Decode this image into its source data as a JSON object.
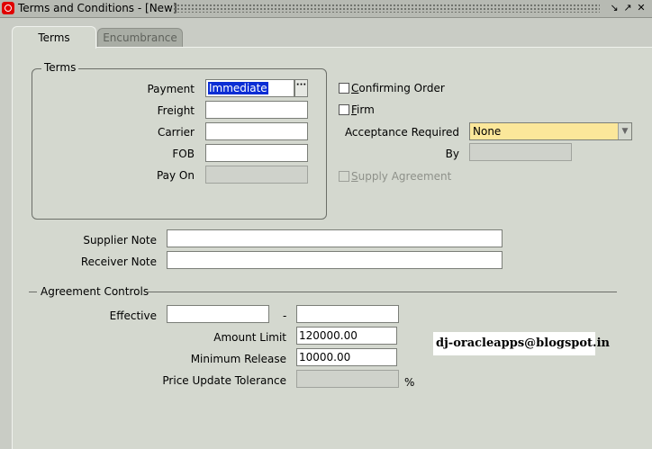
{
  "window": {
    "title": "Terms and Conditions - [New]"
  },
  "tabs": [
    {
      "label": "Terms"
    },
    {
      "label": "Encumbrance"
    }
  ],
  "terms_group": {
    "legend": "Terms",
    "payment": {
      "label": "Payment",
      "value": "Immediate"
    },
    "freight": {
      "label": "Freight",
      "value": ""
    },
    "carrier": {
      "label": "Carrier",
      "value": ""
    },
    "fob": {
      "label": "FOB",
      "value": ""
    },
    "pay_on": {
      "label": "Pay On",
      "value": ""
    }
  },
  "options": {
    "confirming_order": {
      "label": "Confirming Order",
      "checked": false
    },
    "firm": {
      "label": "Firm",
      "checked": false
    },
    "acceptance_required": {
      "label": "Acceptance Required",
      "value": "None"
    },
    "by": {
      "label": "By",
      "value": ""
    },
    "supply_agreement": {
      "label": "Supply Agreement",
      "checked": false,
      "disabled": true
    }
  },
  "notes": {
    "supplier_note": {
      "label": "Supplier Note",
      "value": ""
    },
    "receiver_note": {
      "label": "Receiver Note",
      "value": ""
    }
  },
  "agreement_controls": {
    "heading": "Agreement Controls",
    "effective": {
      "label": "Effective",
      "from": "",
      "separator": "-",
      "to": ""
    },
    "amount_limit": {
      "label": "Amount Limit",
      "value": "120000.00"
    },
    "minimum_release": {
      "label": "Minimum Release",
      "value": "10000.00"
    },
    "price_update_tolerance": {
      "label": "Price Update Tolerance",
      "value": "",
      "unit": "%"
    }
  },
  "watermark": "dj-oracleapps@blogspot.in",
  "colors": {
    "selection": "#0a2dd4",
    "poplist_bg": "#fbe79a",
    "canvas": "#d4d8cf"
  }
}
